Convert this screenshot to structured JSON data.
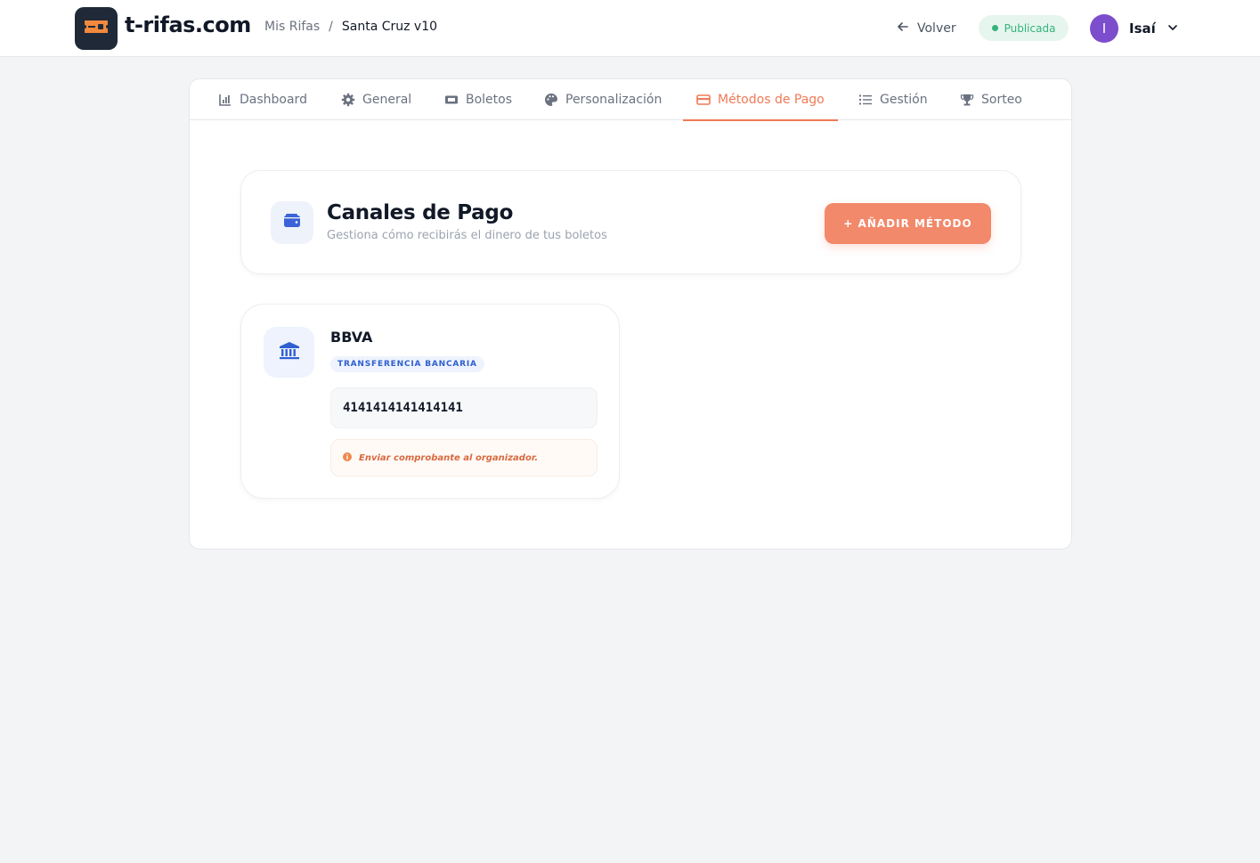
{
  "brand": {
    "name": "t-rifas.com"
  },
  "breadcrumb": {
    "parent": "Mis Rifas",
    "separator": "/",
    "current": "Santa Cruz v10"
  },
  "topbar": {
    "back_label": "Volver",
    "status_label": "Publicada",
    "status_color": "#34b27b",
    "user_initial": "I",
    "user_name": "Isaí"
  },
  "tabs": [
    {
      "label": "Dashboard",
      "icon": "bar-chart-icon",
      "active": false
    },
    {
      "label": "General",
      "icon": "gear-icon",
      "active": false
    },
    {
      "label": "Boletos",
      "icon": "ticket-icon",
      "active": false
    },
    {
      "label": "Personalización",
      "icon": "palette-icon",
      "active": false
    },
    {
      "label": "Métodos de Pago",
      "icon": "credit-card-icon",
      "active": true
    },
    {
      "label": "Gestión",
      "icon": "list-icon",
      "active": false
    },
    {
      "label": "Sorteo",
      "icon": "trophy-icon",
      "active": false
    }
  ],
  "header": {
    "title": "Canales de Pago",
    "subtitle": "Gestiona cómo recibirás el dinero de tus boletos",
    "add_button": "+ AÑADIR MÉTODO"
  },
  "methods": [
    {
      "name": "BBVA",
      "type": "TRANSFERENCIA BANCARIA",
      "account": "4141414141414141",
      "note": "Enviar comprobante al organizador."
    }
  ],
  "colors": {
    "accent": "#f07a55",
    "button": "#f2896b",
    "primary_blue": "#2f5fd0",
    "avatar": "#7c4dcc",
    "logo_bg": "#1f2937"
  }
}
